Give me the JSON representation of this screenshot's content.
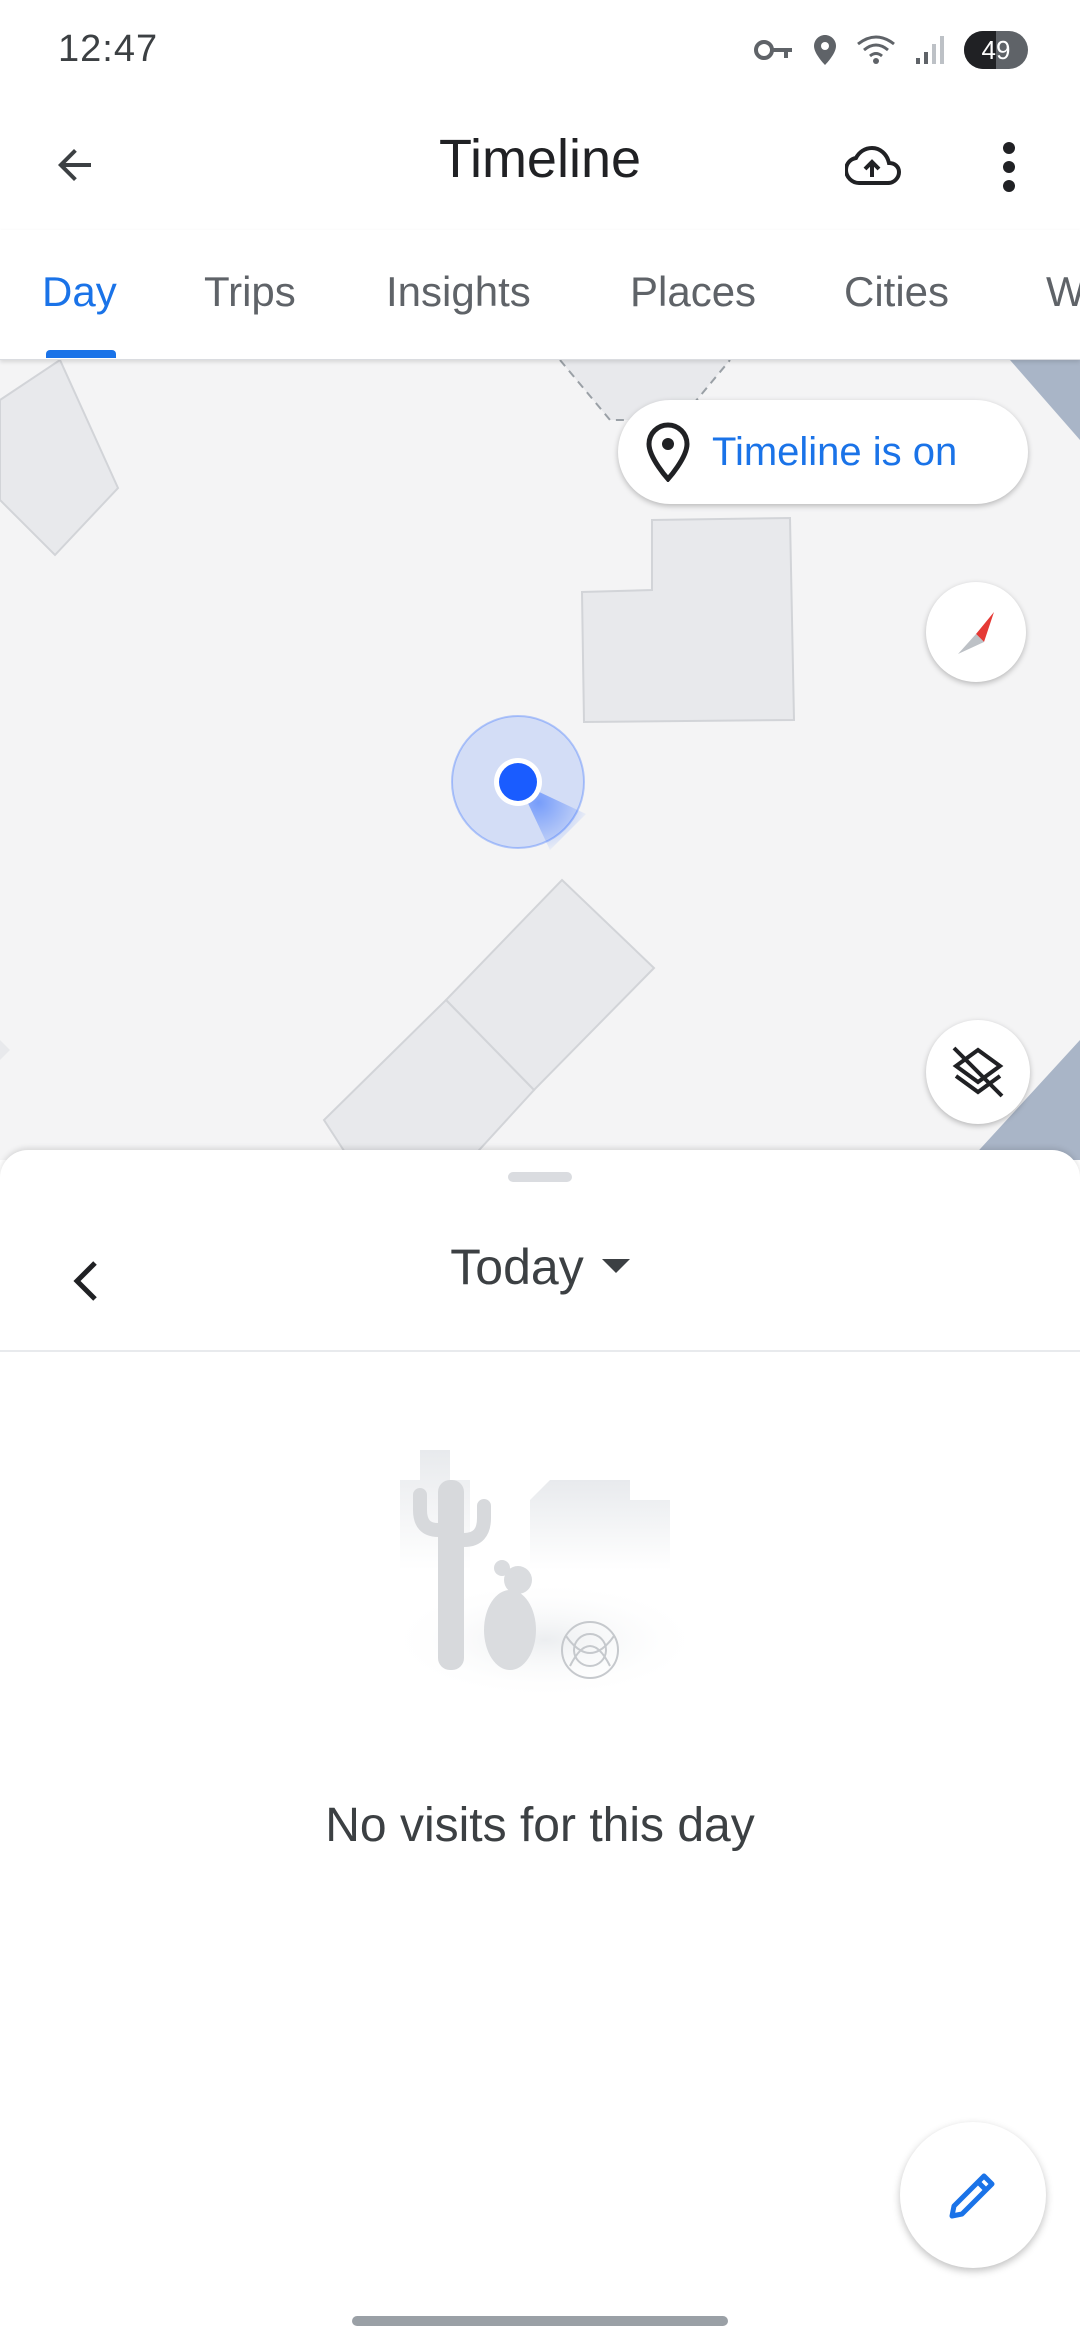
{
  "status_bar": {
    "time": "12:47",
    "battery": "49",
    "icons": [
      "vpn-key-icon",
      "location-icon",
      "wifi-icon",
      "signal-icon",
      "battery-icon"
    ]
  },
  "app_bar": {
    "title": "Timeline",
    "icons": [
      "back-arrow-icon",
      "cloud-upload-icon",
      "more-vert-icon"
    ]
  },
  "tabs": {
    "items": [
      {
        "label": "Day",
        "active": true
      },
      {
        "label": "Trips",
        "active": false
      },
      {
        "label": "Insights",
        "active": false
      },
      {
        "label": "Places",
        "active": false
      },
      {
        "label": "Cities",
        "active": false
      },
      {
        "label": "W",
        "active": false
      }
    ]
  },
  "map": {
    "timeline_chip_label": "Timeline is on",
    "icons": [
      "location-pin-icon",
      "compass-icon",
      "layers-off-icon",
      "current-location-icon"
    ]
  },
  "sheet": {
    "day_label": "Today",
    "empty_message": "No visits for this day",
    "icons": [
      "chevron-left-icon",
      "dropdown-arrow-icon",
      "desert-illustration",
      "edit-pencil-icon"
    ]
  },
  "colors": {
    "accent": "#1a73e8",
    "location_dot": "#1a5cff",
    "compass_red": "#e53935",
    "map_background": "#f4f4f5"
  }
}
